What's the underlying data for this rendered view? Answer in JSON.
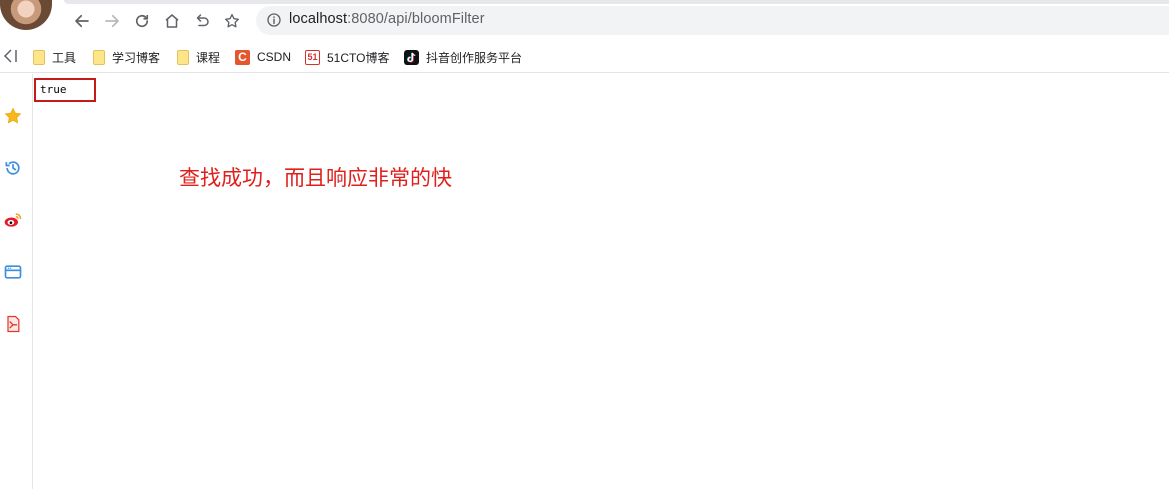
{
  "browser": {
    "url_host": "localhost",
    "url_rest": ":8080/api/bloomFilter"
  },
  "bookmarks": [
    {
      "label": "工具",
      "icon": "folder-icon"
    },
    {
      "label": "学习博客",
      "icon": "folder-icon"
    },
    {
      "label": "课程",
      "icon": "folder-icon"
    },
    {
      "label": "CSDN",
      "icon": "csdn-icon",
      "color": "#e4572e"
    },
    {
      "label": "51CTO博客",
      "icon": "51cto-icon",
      "color": "#d5322e"
    },
    {
      "label": "抖音创作服务平台",
      "icon": "douyin-icon",
      "color": "#111111"
    }
  ],
  "page": {
    "response": "true",
    "annotation": "查找成功，而且响应非常的快"
  },
  "colors": {
    "annotation": "#e0201c",
    "highlight_box": "#c41a1a"
  }
}
